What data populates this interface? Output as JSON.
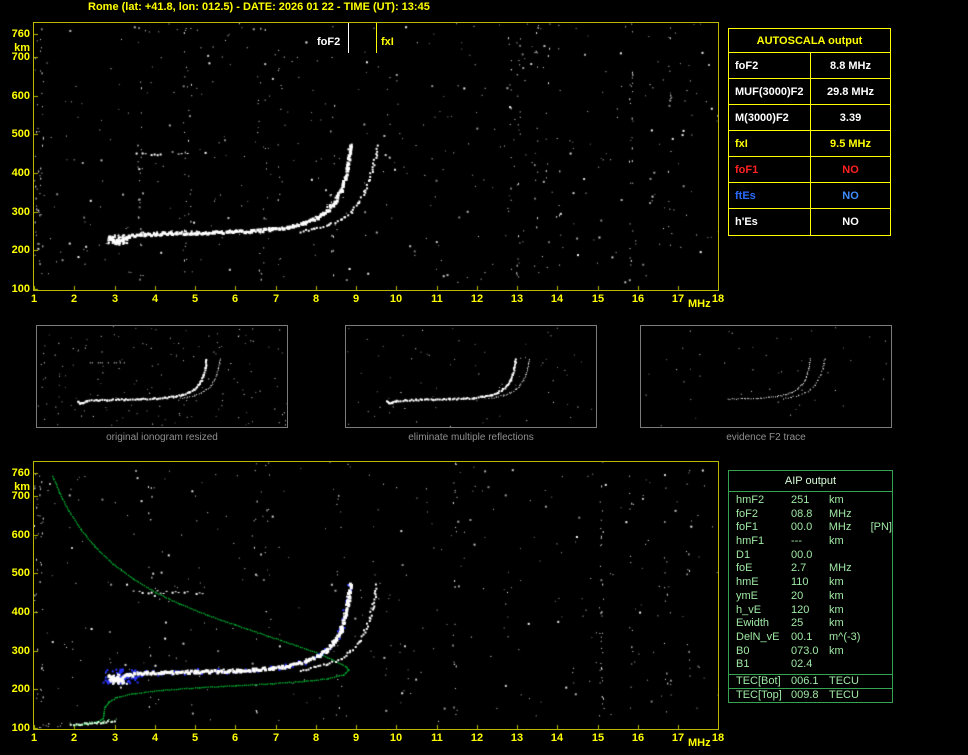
{
  "title": "Rome (lat: +41.8, lon: 012.5) - DATE: 2026 01 22 - TIME (UT): 13:45",
  "colors": {
    "axis_text": "#ffff00",
    "plot_border": "#b9b900",
    "autoscala_border": "#ffff00",
    "aip_border": "#35a352",
    "aip_text": "#9fe8a4",
    "trace": "#ffffff",
    "profile": "#00b232",
    "restored_trace": "#2a35ff"
  },
  "top_plot": {
    "y_ticks": [
      760,
      700,
      600,
      500,
      400,
      300,
      200,
      100
    ],
    "y_unit": "km",
    "x_ticks": [
      1,
      2,
      3,
      4,
      5,
      6,
      7,
      8,
      9,
      10,
      11,
      12,
      13,
      14,
      15,
      16,
      17,
      18
    ],
    "x_unit": "MHz",
    "markers": [
      {
        "id": "foF2",
        "label": "foF2",
        "freq": 8.8,
        "color": "#ffffff"
      },
      {
        "id": "fxI",
        "label": "fxI",
        "freq": 9.5,
        "color": "#ffff00"
      }
    ]
  },
  "bottom_plot": {
    "y_ticks": [
      760,
      700,
      600,
      500,
      400,
      300,
      200,
      100
    ],
    "y_unit": "km",
    "x_ticks": [
      1,
      2,
      3,
      4,
      5,
      6,
      7,
      8,
      9,
      10,
      11,
      12,
      13,
      14,
      15,
      16,
      17,
      18
    ],
    "x_unit": "MHz"
  },
  "autoscala_table": {
    "title": "AUTOSCALA output",
    "rows": [
      {
        "param": "foF2",
        "value": "8.8 MHz",
        "color": "#ffffff",
        "value_color": "#ffffff"
      },
      {
        "param": "MUF(3000)F2",
        "value": "29.8 MHz",
        "color": "#ffffff",
        "value_color": "#ffffff"
      },
      {
        "param": "M(3000)F2",
        "value": "3.39",
        "color": "#ffffff",
        "value_color": "#ffffff"
      },
      {
        "param": "fxI",
        "value": "9.5 MHz",
        "color": "#ffff00",
        "value_color": "#ffff00"
      },
      {
        "param": "foF1",
        "value": "NO",
        "color": "#ff2222",
        "value_color": "#ff2222"
      },
      {
        "param": "ftEs",
        "value": "NO",
        "color": "#2a6bff",
        "value_color": "#3f8cff"
      },
      {
        "param": "h'Es",
        "value": "NO",
        "color": "#ffffff",
        "value_color": "#ffffff"
      }
    ]
  },
  "thumbnails": [
    {
      "caption": "original ionogram resized"
    },
    {
      "caption": "eliminate multiple reflections"
    },
    {
      "caption": "evidence F2 trace"
    }
  ],
  "aip_table": {
    "title": "AIP output",
    "rows": [
      {
        "param": "hmF2",
        "value": "251",
        "unit": "km"
      },
      {
        "param": "foF2",
        "value": "08.8",
        "unit": "MHz"
      },
      {
        "param": "foF1",
        "value": "00.0",
        "unit": "MHz",
        "extra": "[PN]"
      },
      {
        "param": "hmF1",
        "value": "---",
        "unit": "km"
      },
      {
        "param": "D1",
        "value": "00.0",
        "unit": ""
      },
      {
        "param": "foE",
        "value": "2.7",
        "unit": "MHz"
      },
      {
        "param": "hmE",
        "value": "110",
        "unit": "km"
      },
      {
        "param": "ymE",
        "value": "20",
        "unit": "km"
      },
      {
        "param": "h_vE",
        "value": "120",
        "unit": "km"
      },
      {
        "param": "Ewidth",
        "value": "25",
        "unit": "km"
      },
      {
        "param": "DelN_vE",
        "value": "00.1",
        "unit": "m^(-3)"
      },
      {
        "param": "B0",
        "value": "073.0",
        "unit": "km"
      },
      {
        "param": "B1",
        "value": "02.4",
        "unit": ""
      }
    ],
    "tec_rows": [
      {
        "param": "TEC[Bot]",
        "value": "006.1",
        "unit": "TECU"
      },
      {
        "param": "TEC[Top]",
        "value": "009.8",
        "unit": "TECU"
      }
    ]
  },
  "chart_data": {
    "type": "scatter",
    "title": "Ionogram with AUTOSCALA automatic scaling",
    "x_unit": "MHz",
    "y_unit": "km",
    "x_range": [
      1,
      18
    ],
    "y_range": [
      100,
      760
    ],
    "foF2_MHz": 8.8,
    "fxI_MHz": 9.5,
    "f2_ordinary_trace": [
      [
        2.85,
        236
      ],
      [
        2.95,
        226
      ],
      [
        3.1,
        228
      ],
      [
        3.3,
        239
      ],
      [
        3.7,
        244
      ],
      [
        4.2,
        246
      ],
      [
        5.0,
        248
      ],
      [
        5.8,
        250
      ],
      [
        6.4,
        253
      ],
      [
        6.9,
        257
      ],
      [
        7.3,
        263
      ],
      [
        7.7,
        273
      ],
      [
        8.0,
        287
      ],
      [
        8.25,
        305
      ],
      [
        8.45,
        328
      ],
      [
        8.6,
        356
      ],
      [
        8.7,
        388
      ],
      [
        8.77,
        424
      ],
      [
        8.81,
        455
      ],
      [
        8.83,
        474
      ]
    ],
    "f2_extraordinary_trace": [
      [
        7.6,
        251
      ],
      [
        7.95,
        258
      ],
      [
        8.3,
        268
      ],
      [
        8.6,
        282
      ],
      [
        8.85,
        300
      ],
      [
        9.05,
        324
      ],
      [
        9.2,
        352
      ],
      [
        9.32,
        386
      ],
      [
        9.41,
        420
      ],
      [
        9.47,
        450
      ],
      [
        9.5,
        472
      ]
    ],
    "multiple_reflection_trace": [
      [
        3.45,
        455
      ],
      [
        5.3,
        450
      ]
    ],
    "profile_green": [
      [
        1.45,
        752
      ],
      [
        1.62,
        710
      ],
      [
        1.85,
        662
      ],
      [
        2.15,
        615
      ],
      [
        2.5,
        570
      ],
      [
        2.95,
        525
      ],
      [
        3.45,
        487
      ],
      [
        4.0,
        452
      ],
      [
        4.6,
        422
      ],
      [
        5.3,
        393
      ],
      [
        6.0,
        367
      ],
      [
        6.8,
        339
      ],
      [
        7.5,
        315
      ],
      [
        8.1,
        292
      ],
      [
        8.5,
        273
      ],
      [
        8.75,
        259
      ],
      [
        8.8,
        251
      ],
      [
        8.68,
        239
      ],
      [
        8.3,
        229
      ],
      [
        7.7,
        222
      ],
      [
        6.9,
        216
      ],
      [
        6.0,
        211
      ],
      [
        5.1,
        206
      ],
      [
        4.2,
        199
      ],
      [
        3.5,
        191
      ],
      [
        3.05,
        181
      ],
      [
        2.85,
        169
      ],
      [
        2.75,
        155
      ],
      [
        2.72,
        140
      ],
      [
        2.7,
        126
      ],
      [
        2.55,
        117
      ],
      [
        2.25,
        111
      ],
      [
        2.0,
        108
      ]
    ],
    "e_layer_trace": [
      [
        1.9,
        111
      ],
      [
        2.3,
        113
      ],
      [
        2.7,
        117
      ],
      [
        3.0,
        122
      ]
    ]
  }
}
